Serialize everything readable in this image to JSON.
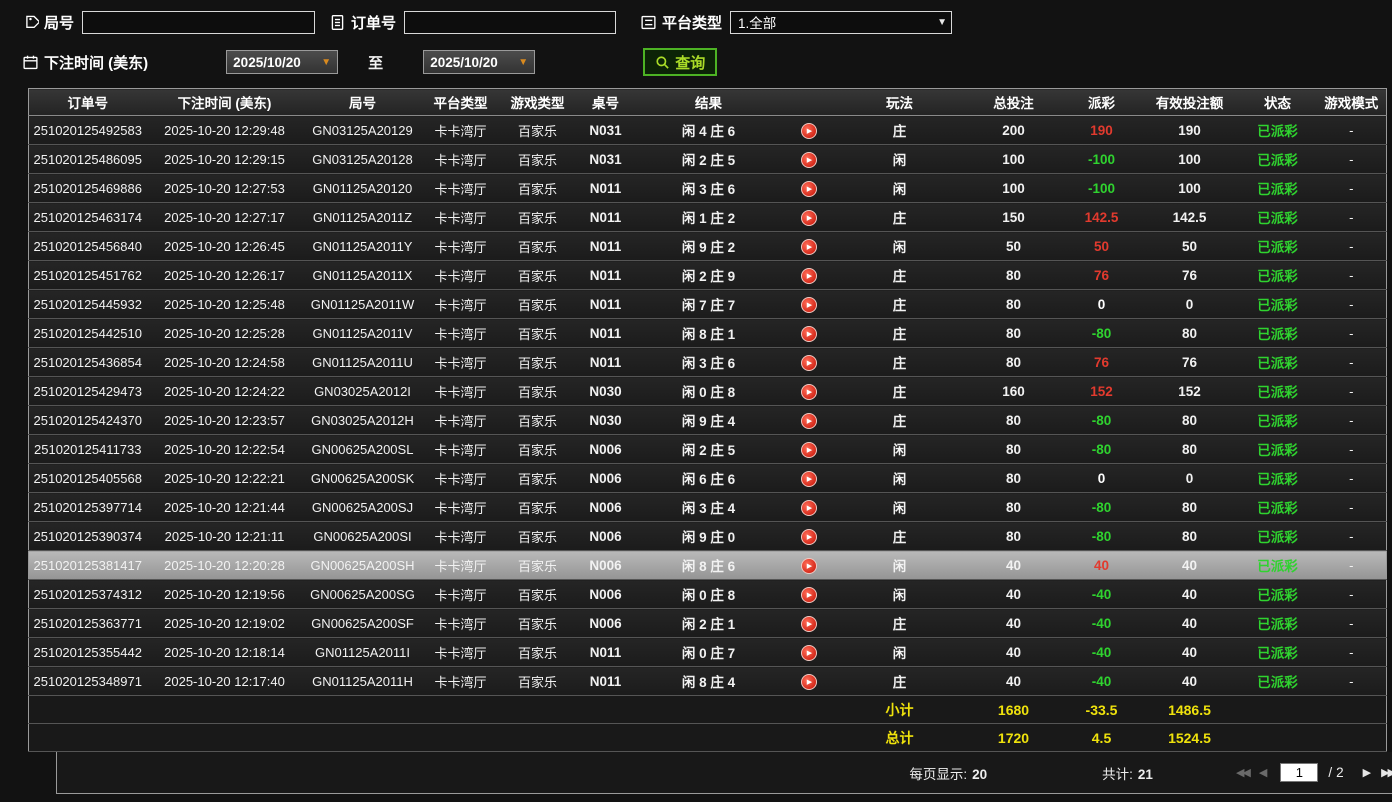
{
  "filters": {
    "game_no": {
      "label": "局号",
      "value": ""
    },
    "order_no": {
      "label": "订单号",
      "value": ""
    },
    "platform": {
      "label": "平台类型",
      "value": "1.全部"
    },
    "bet_time": {
      "label": "下注时间 (美东)",
      "from": "2025/10/20",
      "to_label": "至",
      "to": "2025/10/20"
    },
    "query_label": "查询"
  },
  "icons": {
    "replay": "▶",
    "dropdown": "▼",
    "date_arrow": "▼",
    "first": "◀◀",
    "prev": "◀",
    "next": "▶",
    "last": "▶▶"
  },
  "table": {
    "headers": [
      "订单号",
      "下注时间 (美东)",
      "局号",
      "平台类型",
      "游戏类型",
      "桌号",
      "结果",
      "",
      "玩法",
      "总投注",
      "派彩",
      "有效投注额",
      "状态",
      "游戏模式"
    ],
    "rows": [
      {
        "order_no": "251020125492583",
        "bet_time": "2025-10-20 12:29:48",
        "game_no": "GN03125A20129",
        "platform": "卡卡湾厅",
        "game_type": "百家乐",
        "table_no": "N031",
        "result": "闲 4 庄 6",
        "play": "庄",
        "total_bet": "200",
        "payout": "190",
        "valid_bet": "190",
        "status": "已派彩",
        "mode": "-"
      },
      {
        "order_no": "251020125486095",
        "bet_time": "2025-10-20 12:29:15",
        "game_no": "GN03125A20128",
        "platform": "卡卡湾厅",
        "game_type": "百家乐",
        "table_no": "N031",
        "result": "闲 2 庄 5",
        "play": "闲",
        "total_bet": "100",
        "payout": "-100",
        "valid_bet": "100",
        "status": "已派彩",
        "mode": "-"
      },
      {
        "order_no": "251020125469886",
        "bet_time": "2025-10-20 12:27:53",
        "game_no": "GN01125A20120",
        "platform": "卡卡湾厅",
        "game_type": "百家乐",
        "table_no": "N011",
        "result": "闲 3 庄 6",
        "play": "闲",
        "total_bet": "100",
        "payout": "-100",
        "valid_bet": "100",
        "status": "已派彩",
        "mode": "-"
      },
      {
        "order_no": "251020125463174",
        "bet_time": "2025-10-20 12:27:17",
        "game_no": "GN01125A2011Z",
        "platform": "卡卡湾厅",
        "game_type": "百家乐",
        "table_no": "N011",
        "result": "闲 1 庄 2",
        "play": "庄",
        "total_bet": "150",
        "payout": "142.5",
        "valid_bet": "142.5",
        "status": "已派彩",
        "mode": "-"
      },
      {
        "order_no": "251020125456840",
        "bet_time": "2025-10-20 12:26:45",
        "game_no": "GN01125A2011Y",
        "platform": "卡卡湾厅",
        "game_type": "百家乐",
        "table_no": "N011",
        "result": "闲 9 庄 2",
        "play": "闲",
        "total_bet": "50",
        "payout": "50",
        "valid_bet": "50",
        "status": "已派彩",
        "mode": "-"
      },
      {
        "order_no": "251020125451762",
        "bet_time": "2025-10-20 12:26:17",
        "game_no": "GN01125A2011X",
        "platform": "卡卡湾厅",
        "game_type": "百家乐",
        "table_no": "N011",
        "result": "闲 2 庄 9",
        "play": "庄",
        "total_bet": "80",
        "payout": "76",
        "valid_bet": "76",
        "status": "已派彩",
        "mode": "-"
      },
      {
        "order_no": "251020125445932",
        "bet_time": "2025-10-20 12:25:48",
        "game_no": "GN01125A2011W",
        "platform": "卡卡湾厅",
        "game_type": "百家乐",
        "table_no": "N011",
        "result": "闲 7 庄 7",
        "play": "庄",
        "total_bet": "80",
        "payout": "0",
        "valid_bet": "0",
        "status": "已派彩",
        "mode": "-"
      },
      {
        "order_no": "251020125442510",
        "bet_time": "2025-10-20 12:25:28",
        "game_no": "GN01125A2011V",
        "platform": "卡卡湾厅",
        "game_type": "百家乐",
        "table_no": "N011",
        "result": "闲 8 庄 1",
        "play": "庄",
        "total_bet": "80",
        "payout": "-80",
        "valid_bet": "80",
        "status": "已派彩",
        "mode": "-"
      },
      {
        "order_no": "251020125436854",
        "bet_time": "2025-10-20 12:24:58",
        "game_no": "GN01125A2011U",
        "platform": "卡卡湾厅",
        "game_type": "百家乐",
        "table_no": "N011",
        "result": "闲 3 庄 6",
        "play": "庄",
        "total_bet": "80",
        "payout": "76",
        "valid_bet": "76",
        "status": "已派彩",
        "mode": "-"
      },
      {
        "order_no": "251020125429473",
        "bet_time": "2025-10-20 12:24:22",
        "game_no": "GN03025A2012I",
        "platform": "卡卡湾厅",
        "game_type": "百家乐",
        "table_no": "N030",
        "result": "闲 0 庄 8",
        "play": "庄",
        "total_bet": "160",
        "payout": "152",
        "valid_bet": "152",
        "status": "已派彩",
        "mode": "-"
      },
      {
        "order_no": "251020125424370",
        "bet_time": "2025-10-20 12:23:57",
        "game_no": "GN03025A2012H",
        "platform": "卡卡湾厅",
        "game_type": "百家乐",
        "table_no": "N030",
        "result": "闲 9 庄 4",
        "play": "庄",
        "total_bet": "80",
        "payout": "-80",
        "valid_bet": "80",
        "status": "已派彩",
        "mode": "-"
      },
      {
        "order_no": "251020125411733",
        "bet_time": "2025-10-20 12:22:54",
        "game_no": "GN00625A200SL",
        "platform": "卡卡湾厅",
        "game_type": "百家乐",
        "table_no": "N006",
        "result": "闲 2 庄 5",
        "play": "闲",
        "total_bet": "80",
        "payout": "-80",
        "valid_bet": "80",
        "status": "已派彩",
        "mode": "-"
      },
      {
        "order_no": "251020125405568",
        "bet_time": "2025-10-20 12:22:21",
        "game_no": "GN00625A200SK",
        "platform": "卡卡湾厅",
        "game_type": "百家乐",
        "table_no": "N006",
        "result": "闲 6 庄 6",
        "play": "闲",
        "total_bet": "80",
        "payout": "0",
        "valid_bet": "0",
        "status": "已派彩",
        "mode": "-"
      },
      {
        "order_no": "251020125397714",
        "bet_time": "2025-10-20 12:21:44",
        "game_no": "GN00625A200SJ",
        "platform": "卡卡湾厅",
        "game_type": "百家乐",
        "table_no": "N006",
        "result": "闲 3 庄 4",
        "play": "闲",
        "total_bet": "80",
        "payout": "-80",
        "valid_bet": "80",
        "status": "已派彩",
        "mode": "-"
      },
      {
        "order_no": "251020125390374",
        "bet_time": "2025-10-20 12:21:11",
        "game_no": "GN00625A200SI",
        "platform": "卡卡湾厅",
        "game_type": "百家乐",
        "table_no": "N006",
        "result": "闲 9 庄 0",
        "play": "庄",
        "total_bet": "80",
        "payout": "-80",
        "valid_bet": "80",
        "status": "已派彩",
        "mode": "-"
      },
      {
        "order_no": "251020125381417",
        "bet_time": "2025-10-20 12:20:28",
        "game_no": "GN00625A200SH",
        "platform": "卡卡湾厅",
        "game_type": "百家乐",
        "table_no": "N006",
        "result": "闲 8 庄 6",
        "play": "闲",
        "total_bet": "40",
        "payout": "40",
        "valid_bet": "40",
        "status": "已派彩",
        "mode": "-",
        "selected": true
      },
      {
        "order_no": "251020125374312",
        "bet_time": "2025-10-20 12:19:56",
        "game_no": "GN00625A200SG",
        "platform": "卡卡湾厅",
        "game_type": "百家乐",
        "table_no": "N006",
        "result": "闲 0 庄 8",
        "play": "闲",
        "total_bet": "40",
        "payout": "-40",
        "valid_bet": "40",
        "status": "已派彩",
        "mode": "-"
      },
      {
        "order_no": "251020125363771",
        "bet_time": "2025-10-20 12:19:02",
        "game_no": "GN00625A200SF",
        "platform": "卡卡湾厅",
        "game_type": "百家乐",
        "table_no": "N006",
        "result": "闲 2 庄 1",
        "play": "庄",
        "total_bet": "40",
        "payout": "-40",
        "valid_bet": "40",
        "status": "已派彩",
        "mode": "-"
      },
      {
        "order_no": "251020125355442",
        "bet_time": "2025-10-20 12:18:14",
        "game_no": "GN01125A2011I",
        "platform": "卡卡湾厅",
        "game_type": "百家乐",
        "table_no": "N011",
        "result": "闲 0 庄 7",
        "play": "闲",
        "total_bet": "40",
        "payout": "-40",
        "valid_bet": "40",
        "status": "已派彩",
        "mode": "-"
      },
      {
        "order_no": "251020125348971",
        "bet_time": "2025-10-20 12:17:40",
        "game_no": "GN01125A2011H",
        "platform": "卡卡湾厅",
        "game_type": "百家乐",
        "table_no": "N011",
        "result": "闲 8 庄 4",
        "play": "庄",
        "total_bet": "40",
        "payout": "-40",
        "valid_bet": "40",
        "status": "已派彩",
        "mode": "-"
      }
    ],
    "subtotal": {
      "label": "小计",
      "total_bet": "1680",
      "payout": "-33.5",
      "valid_bet": "1486.5"
    },
    "total": {
      "label": "总计",
      "total_bet": "1720",
      "payout": "4.5",
      "valid_bet": "1524.5"
    }
  },
  "pagination": {
    "per_page_label": "每页显示:",
    "per_page_value": "20",
    "total_label": "共计:",
    "total_value": "21",
    "current_page": "1",
    "separator": "/",
    "total_pages": "2"
  },
  "colors": {
    "win_payout": "#e23a2e",
    "lose_payout": "#2fd32f",
    "status_paid": "#2fd32f",
    "summary_yellow": "#efe20c",
    "query_green": "#aadc28",
    "date_arrow_orange": "#d98a1f"
  }
}
